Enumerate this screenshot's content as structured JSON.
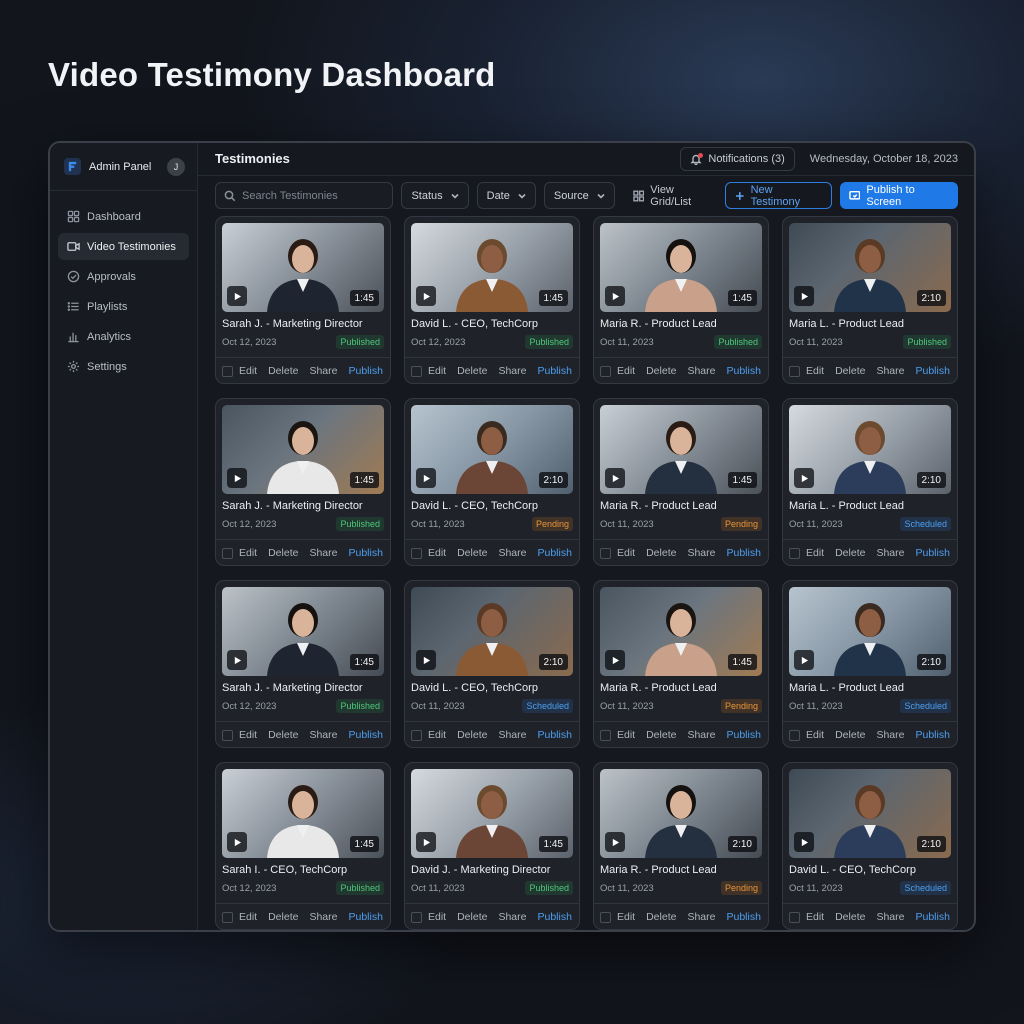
{
  "page": {
    "title": "Video Testimony Dashboard"
  },
  "sidebar": {
    "brand": "Admin Panel",
    "avatar": "J",
    "items": [
      {
        "label": "Dashboard",
        "icon": "dashboard-icon",
        "active": false
      },
      {
        "label": "Video Testimonies",
        "icon": "video-icon",
        "active": true
      },
      {
        "label": "Approvals",
        "icon": "check-circle-icon",
        "active": false
      },
      {
        "label": "Playlists",
        "icon": "list-icon",
        "active": false
      },
      {
        "label": "Analytics",
        "icon": "bar-chart-icon",
        "active": false
      },
      {
        "label": "Settings",
        "icon": "gear-icon",
        "active": false
      }
    ]
  },
  "header": {
    "title": "Testimonies",
    "notifications": "Notifications (3)",
    "date": "Wednesday, October 18, 2023"
  },
  "toolbar": {
    "search_placeholder": "Search Testimonies",
    "filters": [
      "Status",
      "Date",
      "Source"
    ],
    "view_toggle": "View Grid/List",
    "new_button": "New Testimony",
    "publish_button": "Publish to Screen"
  },
  "actions": {
    "edit": "Edit",
    "delete": "Delete",
    "share": "Share",
    "publish": "Publish"
  },
  "colors": {
    "accent": "#1f7ae8",
    "published": "#4fc77a",
    "pending": "#e7953a",
    "scheduled": "#4e9ff0"
  },
  "cards": [
    {
      "title": "Sarah J. - Marketing Director",
      "date": "Oct 12, 2023",
      "status": "Published",
      "duration": "1:45"
    },
    {
      "title": "David L. - CEO, TechCorp",
      "date": "Oct 12, 2023",
      "status": "Published",
      "duration": "1:45"
    },
    {
      "title": "Maria R. - Product Lead",
      "date": "Oct 11, 2023",
      "status": "Published",
      "duration": "1:45"
    },
    {
      "title": "Maria L. - Product Lead",
      "date": "Oct 11, 2023",
      "status": "Published",
      "duration": "2:10"
    },
    {
      "title": "Sarah J. - Marketing Director",
      "date": "Oct 12, 2023",
      "status": "Published",
      "duration": "1:45"
    },
    {
      "title": "David L. - CEO, TechCorp",
      "date": "Oct 11, 2023",
      "status": "Pending",
      "duration": "2:10"
    },
    {
      "title": "Maria R. - Product Lead",
      "date": "Oct 11, 2023",
      "status": "Pending",
      "duration": "1:45"
    },
    {
      "title": "Maria L. - Product Lead",
      "date": "Oct 11, 2023",
      "status": "Scheduled",
      "duration": "2:10"
    },
    {
      "title": "Sarah J. - Marketing Director",
      "date": "Oct 12, 2023",
      "status": "Published",
      "duration": "1:45"
    },
    {
      "title": "David L. - CEO, TechCorp",
      "date": "Oct 11, 2023",
      "status": "Scheduled",
      "duration": "2:10"
    },
    {
      "title": "Maria R. - Product Lead",
      "date": "Oct 11, 2023",
      "status": "Pending",
      "duration": "1:45"
    },
    {
      "title": "Maria L. - Product Lead",
      "date": "Oct 11, 2023",
      "status": "Scheduled",
      "duration": "2:10"
    },
    {
      "title": "Sarah I. - CEO, TechCorp",
      "date": "Oct 12, 2023",
      "status": "Published",
      "duration": "1:45"
    },
    {
      "title": "David J. - Marketing Director",
      "date": "Oct 11, 2023",
      "status": "Published",
      "duration": "1:45"
    },
    {
      "title": "Maria R. - Product Lead",
      "date": "Oct 11, 2023",
      "status": "Pending",
      "duration": "2:10"
    },
    {
      "title": "David L. - CEO, TechCorp",
      "date": "Oct 11, 2023",
      "status": "Scheduled",
      "duration": "2:10"
    }
  ]
}
